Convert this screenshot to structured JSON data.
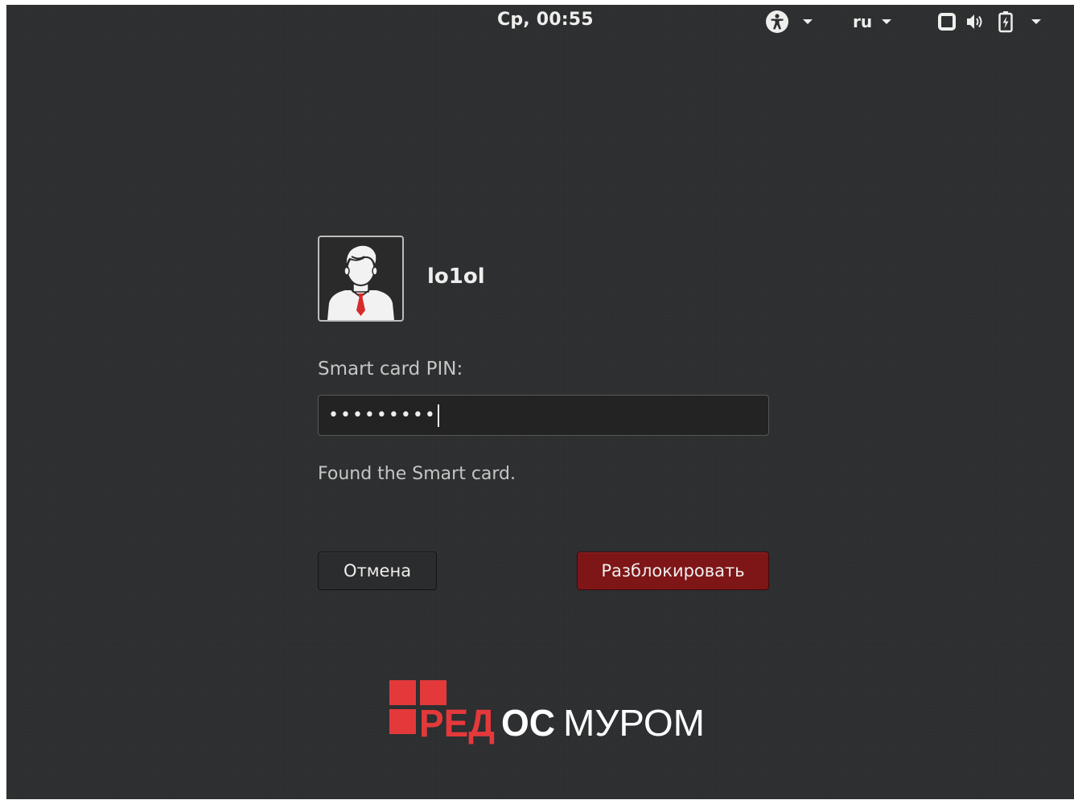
{
  "top_bar": {
    "clock": "Ср, 00:55",
    "language": "ru",
    "icons": [
      "accessibility-icon",
      "window-icon",
      "volume-icon",
      "battery-icon"
    ]
  },
  "login": {
    "username": "lo1ol",
    "avatar": "user-avatar-icon",
    "pin_label": "Smart card PIN:",
    "pin_value": "•••••••••",
    "status_message": "Found the Smart card.",
    "cancel_label": "Отмена",
    "unlock_label": "Разблокировать"
  },
  "logo": {
    "parts": [
      "РЕД",
      "ОС",
      "МУРОМ"
    ],
    "brand_color": "#e4393b"
  },
  "colors": {
    "background": "#2c2e30",
    "accent": "#7e1517",
    "text": "#eeeeec"
  }
}
